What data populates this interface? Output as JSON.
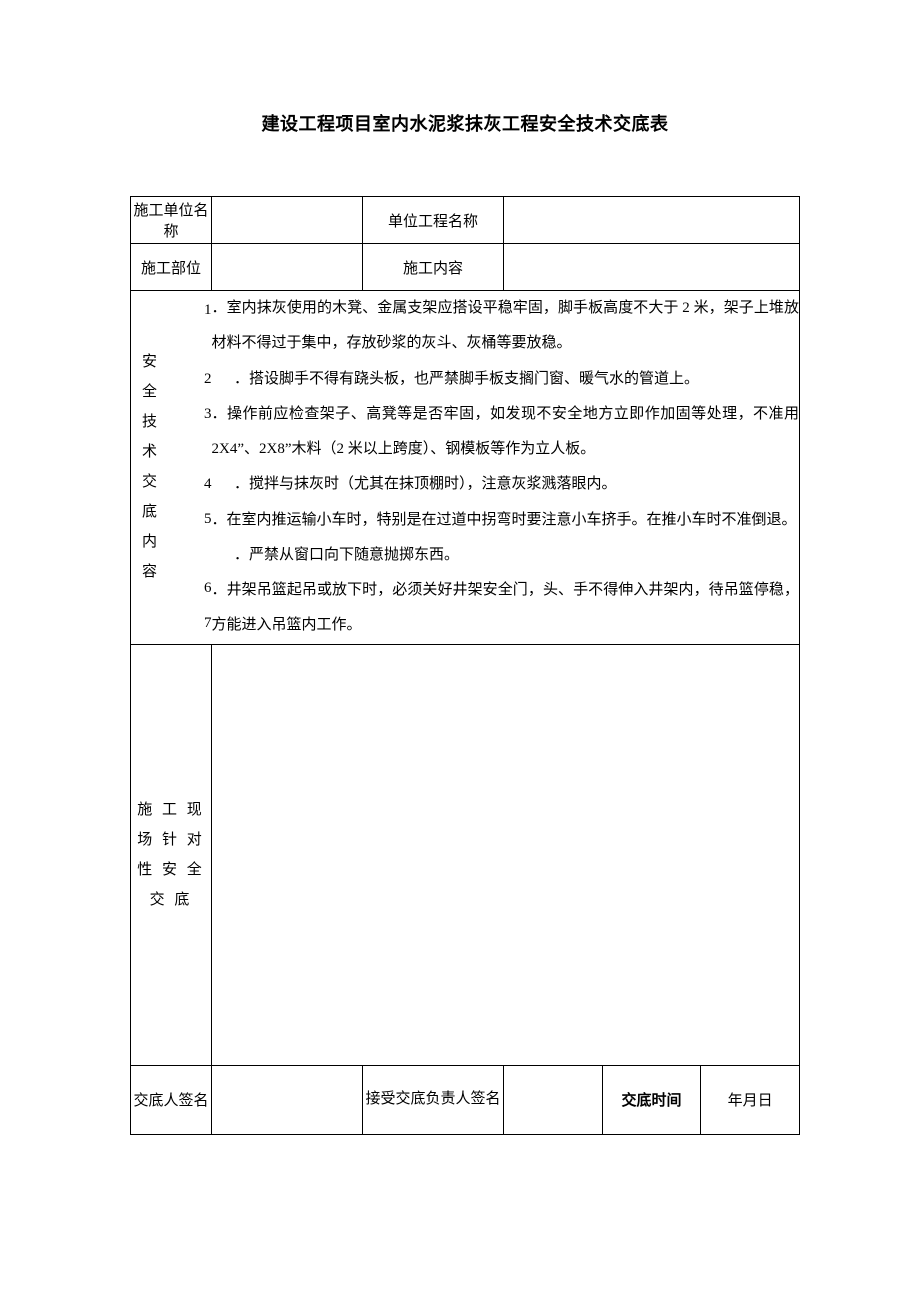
{
  "title": "建设工程项目室内水泥浆抹灰工程安全技术交底表",
  "row1": {
    "label1": "施工单位名称",
    "value1": "",
    "label2": "单位工程名称",
    "value2": ""
  },
  "row2": {
    "label1": "施工部位",
    "value1": "",
    "label2": "施工内容",
    "value2": ""
  },
  "section1": {
    "label": "安 全 技 术 交 底 内 容",
    "items": [
      {
        "no": "1",
        "text": "．室内抹灰使用的木凳、金属支架应搭设平稳牢固，脚手板高度不大于 2 米，架子上堆放材料不得过于集中，存放砂浆的灰斗、灰桶等要放稳。"
      },
      {
        "no": "2",
        "text": "．搭设脚手不得有跷头板，也严禁脚手板支搁门窗、暖气水的管道上。"
      },
      {
        "no": "3",
        "text": "．操作前应检查架子、高凳等是否牢固，如发现不安全地方立即作加固等处理，不准用 2X4”、2X8”木料（2 米以上跨度）、钢模板等作为立人板。"
      },
      {
        "no": "4",
        "text": "．搅拌与抹灰时（尤其在抹顶棚时），注意灰浆溅落眼内。"
      },
      {
        "no": "5",
        "text": "．在室内推运输小车时，特别是在过道中拐弯时要注意小车挤手。在推小车时不准倒退。"
      },
      {
        "no": "6",
        "text": "．严禁从窗口向下随意抛掷东西。"
      },
      {
        "no": "7",
        "text": "．井架吊篮起吊或放下时，必须关好井架安全门，头、手不得伸入井架内，待吊篮停稳，方能进入吊篮内工作。"
      }
    ]
  },
  "section2": {
    "label": "施 工 现 场 针 对 性 安 全 交 底",
    "content": ""
  },
  "sign": {
    "label1": "交底人签名",
    "value1": "",
    "label2": "接受交底负责人签名",
    "value2": "",
    "label3": "交底时间",
    "value3": "年月日"
  }
}
